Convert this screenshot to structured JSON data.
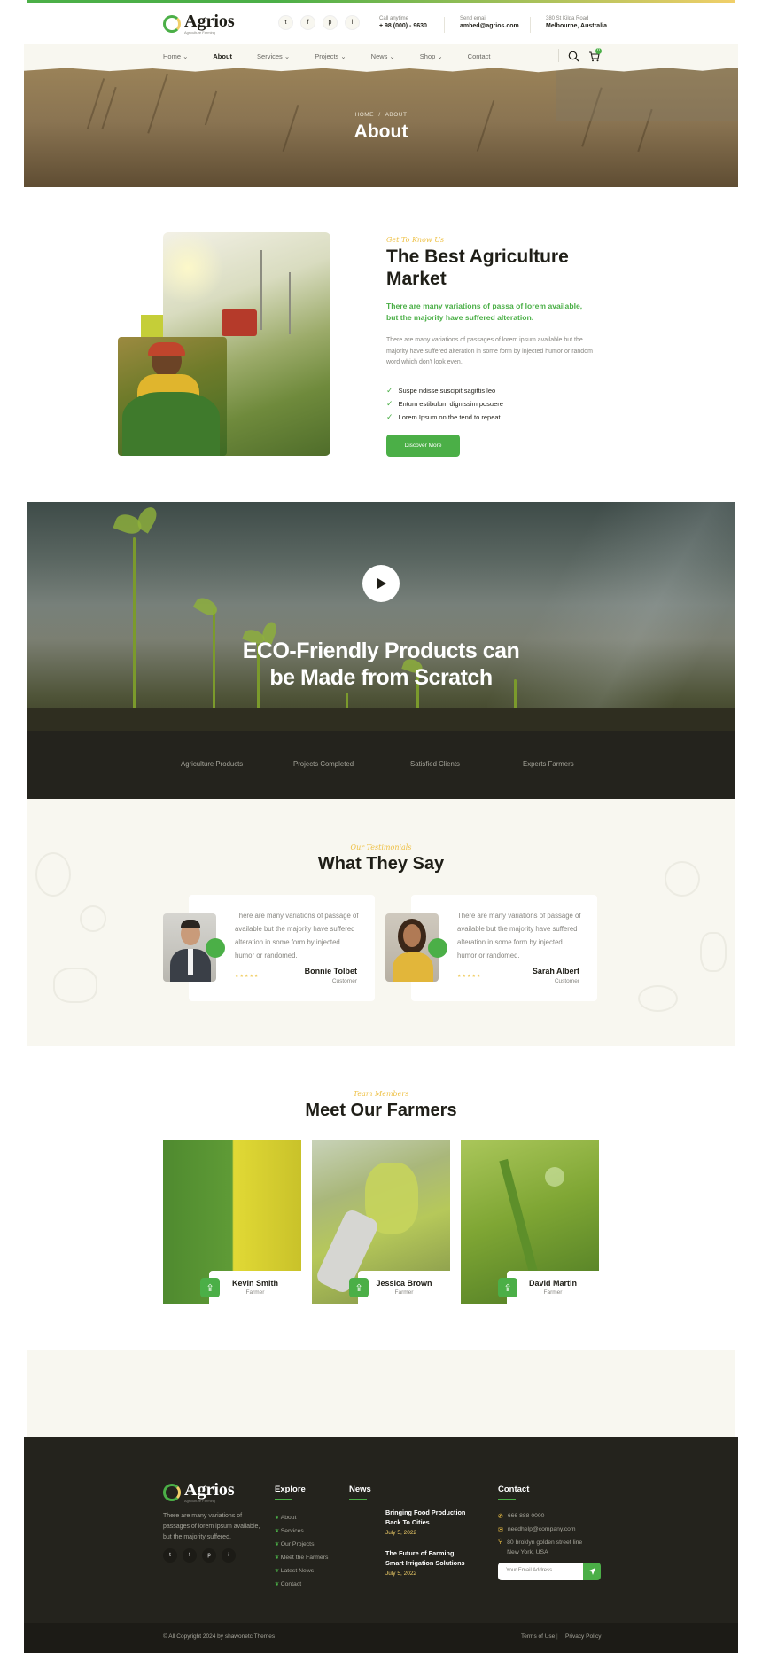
{
  "header": {
    "logo_text": "Agrios",
    "logo_sub": "Agriculture Farming",
    "social": [
      "t",
      "f",
      "p",
      "i"
    ],
    "call_label": "Call anytime",
    "call_value": "+ 98 (000) - 9630",
    "email_label": "Send email",
    "email_value": "ambed@agrios.com",
    "address_label": "380 St Kilda Road",
    "address_value": "Melbourne, Australia",
    "cart_count": "0"
  },
  "nav": {
    "items": [
      {
        "label": "Home ⌄"
      },
      {
        "label": "About"
      },
      {
        "label": "Services ⌄"
      },
      {
        "label": "Projects ⌄"
      },
      {
        "label": "News ⌄"
      },
      {
        "label": "Shop ⌄"
      },
      {
        "label": "Contact"
      }
    ]
  },
  "banner": {
    "breadcrumb_home": "HOME",
    "breadcrumb_sep": "/",
    "breadcrumb_current": "ABOUT",
    "title": "About"
  },
  "about": {
    "tag": "Get To Know Us",
    "title_line1": "The Best Agriculture",
    "title_line2": "Market",
    "highlight": "There are many variations of passa of lorem available, but the majority have suffered alteration.",
    "body": "There are many variations of passages of lorem ipsum available but the majority have suffered alteration in some form by injected humor or random word which don't look even.",
    "checks": [
      "Suspe ndisse suscipit sagittis leo",
      "Entum estibulum dignissim posuere",
      "Lorem Ipsum on the tend to repeat"
    ],
    "button": "Discover More"
  },
  "video": {
    "title_line1": "ECO-Friendly Products can",
    "title_line2": "be Made from Scratch"
  },
  "stats": [
    "Agriculture Products",
    "Projects Completed",
    "Satisfied Clients",
    "Experts Farmers"
  ],
  "testimonials": {
    "tag": "Our Testimonials",
    "title": "What They Say",
    "items": [
      {
        "text": "There are many variations of passage of available but the majority have suffered alteration in some form by injected humor or randomed.",
        "name": "Bonnie Tolbet",
        "role": "Customer"
      },
      {
        "text": "There are many variations of passage of available but the majority have suffered alteration in some form by injected humor or randomed.",
        "name": "Sarah Albert",
        "role": "Customer"
      }
    ]
  },
  "farmers": {
    "tag": "Team Members",
    "title": "Meet Our Farmers",
    "items": [
      {
        "name": "Kevin Smith",
        "role": "Farmer"
      },
      {
        "name": "Jessica Brown",
        "role": "Farmer"
      },
      {
        "name": "David Martin",
        "role": "Farmer"
      }
    ]
  },
  "footer": {
    "about_text": "There are many variations of passages of lorem ipsum available, but the majority suffered.",
    "explore_title": "Explore",
    "explore_links": [
      "About",
      "Services",
      "Our Projects",
      "Meet the Farmers",
      "Latest News",
      "Contact"
    ],
    "news_title": "News",
    "news": [
      {
        "title_line1": "Bringing Food Production",
        "title_line2": "Back To Cities",
        "date": "July 5, 2022"
      },
      {
        "title_line1": "The Future of Farming,",
        "title_line2": "Smart Irrigation Solutions",
        "date": "July 5, 2022"
      }
    ],
    "contact_title": "Contact",
    "phone": "666 888 0000",
    "email": "needhelp@company.com",
    "address_line1": "80 broklyn golden street line",
    "address_line2": "New York, USA",
    "email_placeholder": "Your Email Address",
    "copyright": "© All Copyright 2024 by shawonetc Themes",
    "terms": "Terms of Use",
    "privacy": "Privacy Policy",
    "bottom_sep": "|"
  },
  "colors": {
    "primary_green": "#4baf47",
    "accent_yellow": "#eec044",
    "dark": "#1f1e17",
    "cream": "#f8f7f0"
  }
}
